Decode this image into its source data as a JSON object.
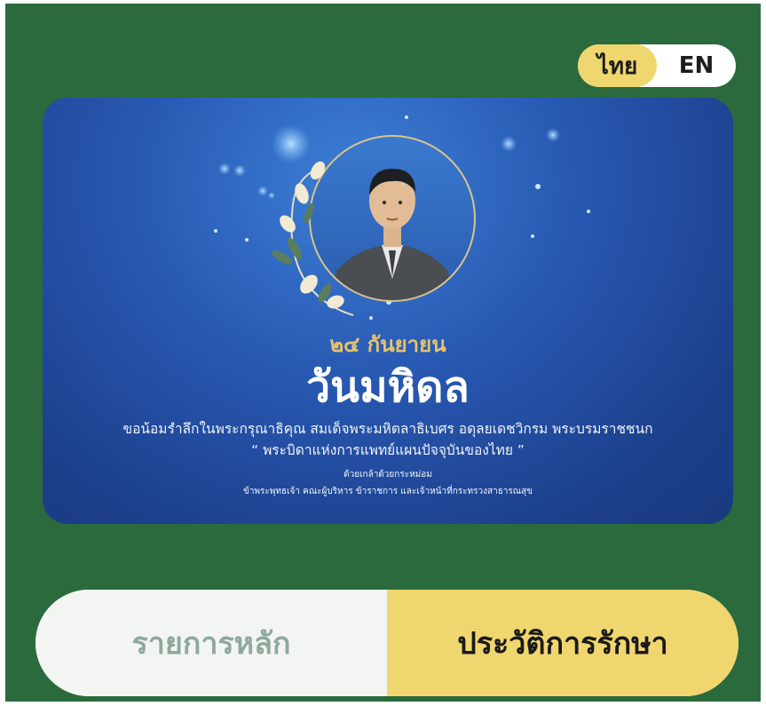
{
  "language_toggle": {
    "thai_label": "ไทย",
    "english_label": "EN",
    "active": "thai"
  },
  "banner": {
    "date": "๒๔ กันยายน",
    "title": "วันมหิดล",
    "line1": "ขอน้อมรำลึกในพระกรุณาธิคุณ สมเด็จพระมหิตลาธิเบศร อดุลยเดชวิกรม พระบรมราชชนก",
    "line2": "“ พระบิดาแห่งการแพทย์แผนปัจจุบันของไทย ”",
    "small1": "ด้วยเกล้าด้วยกระหม่อม",
    "small2": "ข้าพระพุทธเจ้า คณะผู้บริหาร ข้าราชการ และเจ้าหน้าที่กระทรวงสาธารณสุข"
  },
  "bottom_nav": {
    "main_menu_label": "รายการหลัก",
    "history_label": "ประวัติการรักษา",
    "active": "history"
  },
  "colors": {
    "app_background": "#2b6a3c",
    "accent_yellow": "#f0d66e",
    "banner_blue": "#2859b3",
    "gold": "#e8c26a"
  }
}
